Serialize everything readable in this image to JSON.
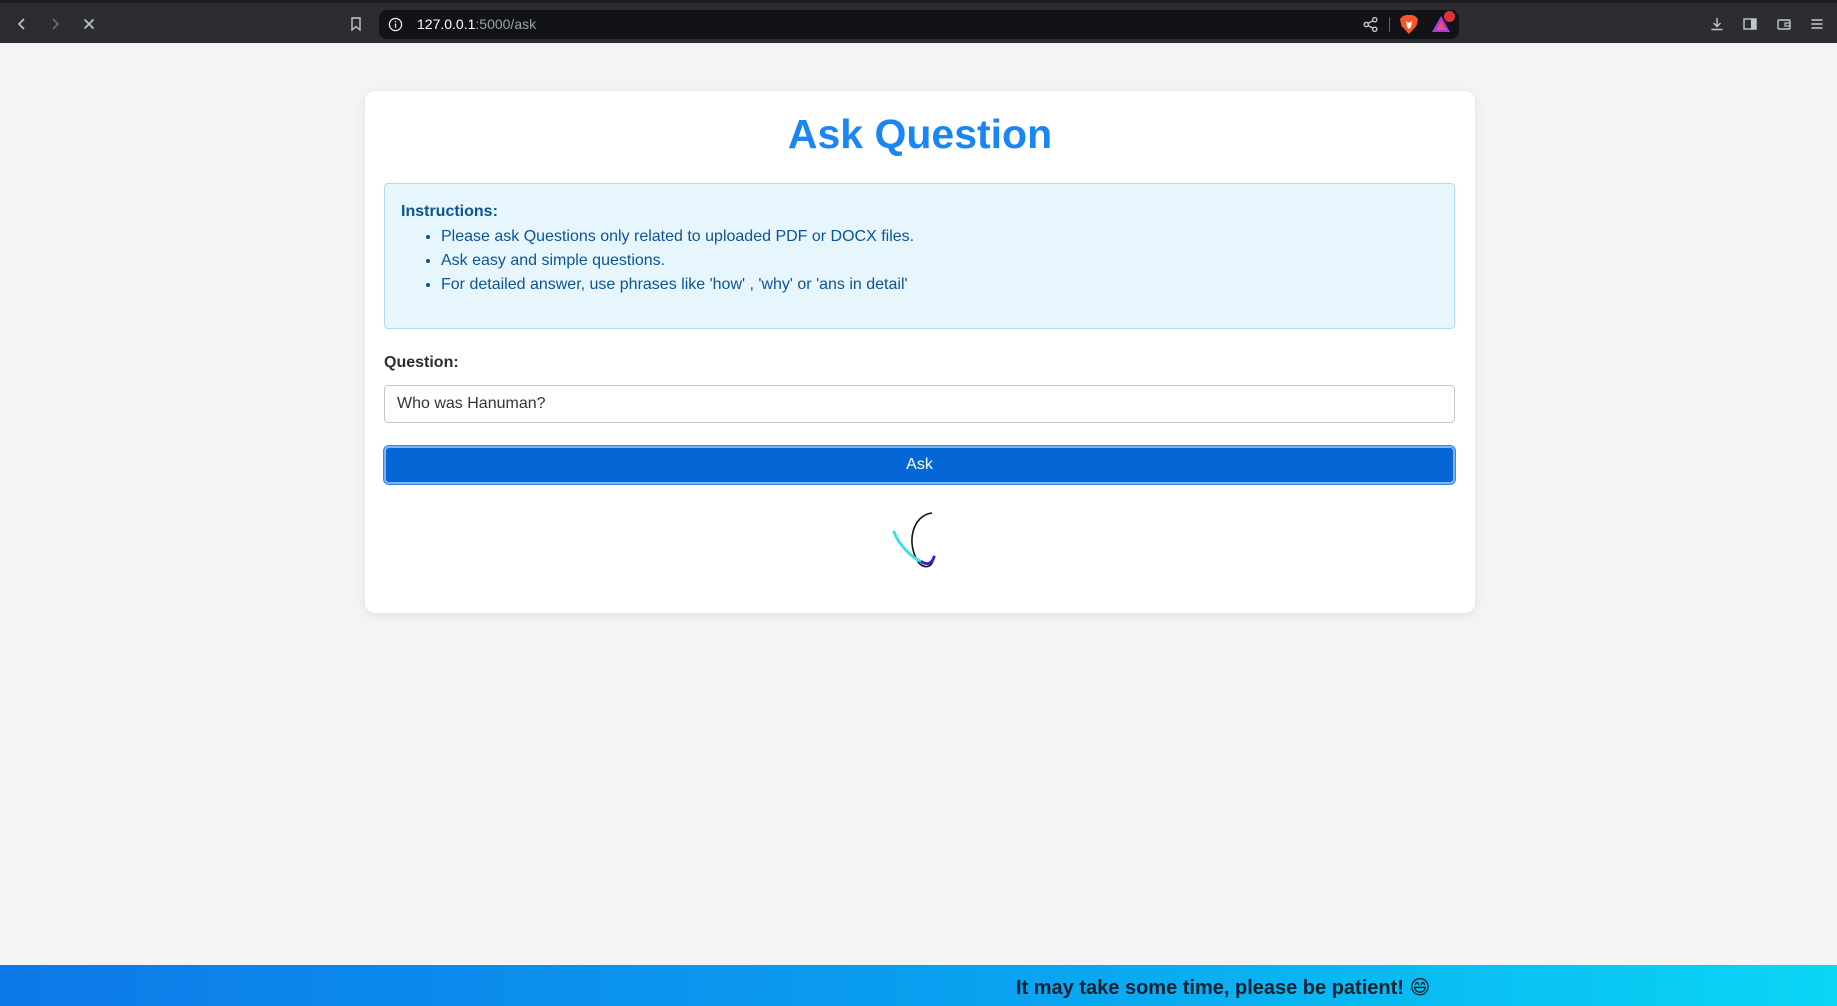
{
  "browser": {
    "url_host": "127.0.0.1",
    "url_path": ":5000/ask",
    "notification_count": "1",
    "icons": [
      "back-icon",
      "forward-icon",
      "stop-icon",
      "bookmark-icon",
      "info-icon",
      "share-icon",
      "brave-shield-icon",
      "brave-rewards-icon",
      "download-icon",
      "sidebar-icon",
      "wallet-icon",
      "menu-icon"
    ]
  },
  "page": {
    "title": "Ask Question",
    "instructions": {
      "heading": "Instructions:",
      "items": [
        "Please ask Questions only related to uploaded PDF or DOCX files.",
        "Ask easy and simple questions.",
        "For detailed answer, use phrases like 'how' , 'why' or 'ans in detail'"
      ]
    },
    "question": {
      "label": "Question:",
      "value": "Who was Hanuman?"
    },
    "ask_button": "Ask",
    "banner": "It may take some time, please be patient! 😄"
  },
  "colors": {
    "title": "#1a85f5",
    "button": "#0566d5",
    "instructions_bg": "#e7f6fd",
    "instructions_text": "#0c5495"
  }
}
